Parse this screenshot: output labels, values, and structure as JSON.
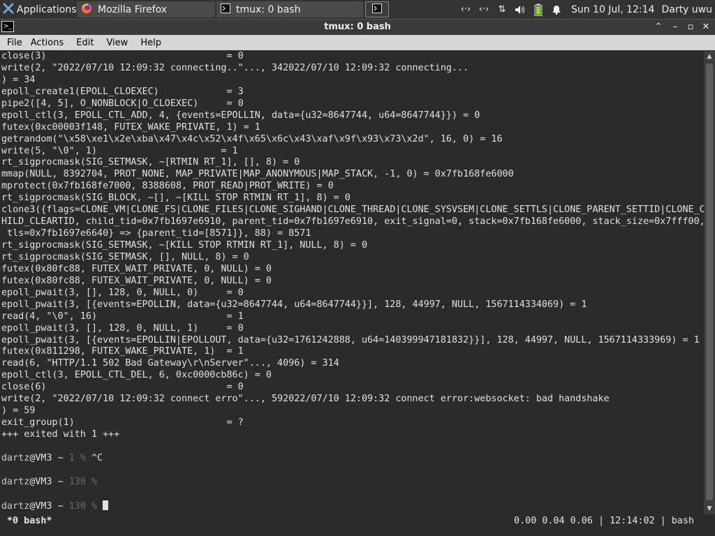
{
  "panel": {
    "applications_label": "Applications",
    "tasks": [
      {
        "label": "Mozilla Firefox",
        "icon": "firefox-icon"
      },
      {
        "label": "tmux: 0 bash",
        "icon": "terminal-icon"
      }
    ],
    "clock": "Sun 10 Jul, 12:14",
    "user": "Darty uwu"
  },
  "window": {
    "title": "tmux: 0 bash"
  },
  "menu": {
    "file": "File",
    "actions": "Actions",
    "edit": "Edit",
    "view": "View",
    "help": "Help"
  },
  "terminal": {
    "lines": [
      "close(3)                                = 0",
      "write(2, \"2022/07/10 12:09:32 connecting..\"..., 342022/07/10 12:09:32 connecting...",
      ") = 34",
      "epoll_create1(EPOLL_CLOEXEC)            = 3",
      "pipe2([4, 5], O_NONBLOCK|O_CLOEXEC)     = 0",
      "epoll_ctl(3, EPOLL_CTL_ADD, 4, {events=EPOLLIN, data={u32=8647744, u64=8647744}}) = 0",
      "futex(0xc00003f148, FUTEX_WAKE_PRIVATE, 1) = 1",
      "getrandom(\"\\x58\\xe1\\x2e\\xba\\x47\\x4c\\x52\\x4f\\x65\\x6c\\x43\\xaf\\x9f\\x93\\x73\\x2d\", 16, 0) = 16",
      "write(5, \"\\0\", 1)                      = 1",
      "rt_sigprocmask(SIG_SETMASK, ~[RTMIN RT_1], [], 8) = 0",
      "mmap(NULL, 8392704, PROT_NONE, MAP_PRIVATE|MAP_ANONYMOUS|MAP_STACK, -1, 0) = 0x7fb168fe6000",
      "mprotect(0x7fb168fe7000, 8388608, PROT_READ|PROT_WRITE) = 0",
      "rt_sigprocmask(SIG_BLOCK, ~[], ~[KILL STOP RTMIN RT_1], 8) = 0",
      "clone3({flags=CLONE_VM|CLONE_FS|CLONE_FILES|CLONE_SIGHAND|CLONE_THREAD|CLONE_SYSVSEM|CLONE_SETTLS|CLONE_PARENT_SETTID|CLONE_C",
      "HILD_CLEARTID, child_tid=0x7fb1697e6910, parent_tid=0x7fb1697e6910, exit_signal=0, stack=0x7fb168fe6000, stack_size=0x7fff00,",
      " tls=0x7fb1697e6640} => {parent_tid=[8571]}, 88) = 8571",
      "rt_sigprocmask(SIG_SETMASK, ~[KILL STOP RTMIN RT_1], NULL, 8) = 0",
      "rt_sigprocmask(SIG_SETMASK, [], NULL, 8) = 0",
      "futex(0x80fc88, FUTEX_WAIT_PRIVATE, 0, NULL) = 0",
      "futex(0x80fc88, FUTEX_WAIT_PRIVATE, 0, NULL) = 0",
      "epoll_pwait(3, [], 128, 0, NULL, 0)     = 0",
      "epoll_pwait(3, [{events=EPOLLIN, data={u32=8647744, u64=8647744}}], 128, 44997, NULL, 1567114334069) = 1",
      "read(4, \"\\0\", 16)                       = 1",
      "epoll_pwait(3, [], 128, 0, NULL, 1)     = 0",
      "epoll_pwait(3, [{events=EPOLLIN|EPOLLOUT, data={u32=1761242888, u64=140399947181832}}], 128, 44997, NULL, 1567114333969) = 1",
      "futex(0x811298, FUTEX_WAKE_PRIVATE, 1)  = 1",
      "read(6, \"HTTP/1.1 502 Bad Gateway\\r\\nServer\"..., 4096) = 314",
      "epoll_ctl(3, EPOLL_CTL_DEL, 6, 0xc0000cb86c) = 0",
      "close(6)                                = 0",
      "write(2, \"2022/07/10 12:09:32 connect erro\"..., 592022/07/10 12:09:32 connect error:websocket: bad handshake",
      ") = 59",
      "exit_group(1)                           = ?",
      "+++ exited with 1 +++",
      ""
    ],
    "prompts": [
      {
        "user": "dartz",
        "host": "@VM3 ~ ",
        "status": "1 %",
        "input": " ^C"
      },
      {
        "user": "dartz",
        "host": "@VM3 ~ ",
        "status": "130 %",
        "input": ""
      },
      {
        "user": "dartz",
        "host": "@VM3 ~ ",
        "status": "130 %",
        "input": " "
      }
    ]
  },
  "status": {
    "window": "*0 bash*",
    "right": "0.00 0.04 0.06 | 12:14:02 | bash"
  }
}
